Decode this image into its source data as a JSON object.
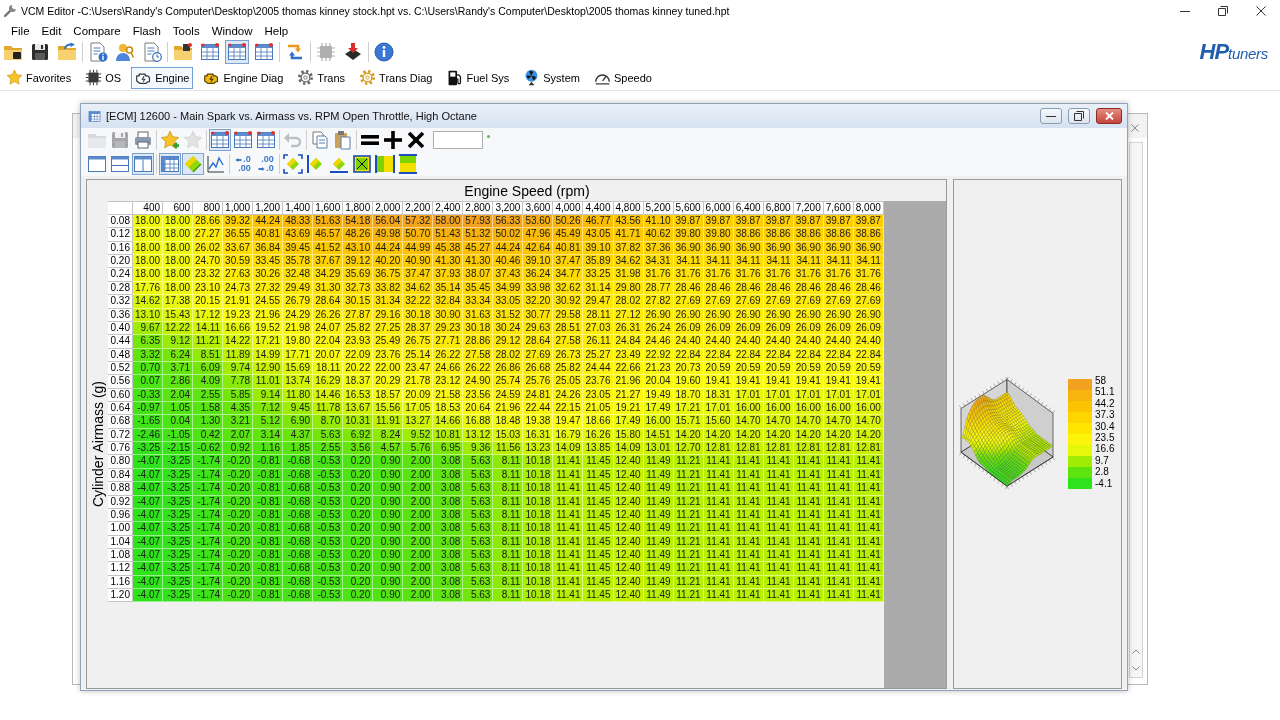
{
  "window": {
    "title": "VCM Editor -C:\\Users\\Randy's Computer\\Desktop\\2005 thomas kinney stock.hpt vs. C:\\Users\\Randy's Computer\\Desktop\\2005 thomas kinney tuned.hpt"
  },
  "menu": [
    "File",
    "Edit",
    "Compare",
    "Flash",
    "Tools",
    "Window",
    "Help"
  ],
  "toolbar": [
    [
      {
        "kind": "open-folder",
        "pressed": false,
        "disabled": false
      },
      {
        "kind": "save",
        "pressed": false,
        "disabled": false
      },
      {
        "kind": "folder-arrow",
        "pressed": false,
        "disabled": false
      }
    ],
    [
      {
        "kind": "doc-info",
        "pressed": false,
        "disabled": false
      },
      {
        "kind": "key-user",
        "pressed": false,
        "disabled": false
      },
      {
        "kind": "doc-clock",
        "pressed": false,
        "disabled": false
      }
    ],
    [
      {
        "kind": "folder-chip",
        "pressed": false,
        "disabled": false
      },
      {
        "kind": "table-grid",
        "pressed": false,
        "disabled": false
      },
      {
        "kind": "table-grid",
        "pressed": true,
        "disabled": false
      },
      {
        "kind": "table-grid",
        "pressed": false,
        "disabled": false
      }
    ],
    [
      {
        "kind": "swap",
        "pressed": false,
        "disabled": false
      }
    ],
    [
      {
        "kind": "chip",
        "pressed": false,
        "disabled": true
      },
      {
        "kind": "chip-down",
        "pressed": false,
        "disabled": false
      }
    ],
    [
      {
        "kind": "info",
        "pressed": false,
        "disabled": false
      }
    ]
  ],
  "logo": "**HP**tuners",
  "categories": [
    {
      "label": "Favorites",
      "kind": "star",
      "selected": false
    },
    {
      "label": "OS",
      "kind": "chip",
      "selected": false
    },
    {
      "label": "Engine",
      "kind": "engine",
      "selected": true
    },
    {
      "label": "Engine Diag",
      "kind": "engine-warning",
      "selected": false
    },
    {
      "label": "Trans",
      "kind": "gear",
      "selected": false
    },
    {
      "label": "Trans Diag",
      "kind": "gear-gold",
      "selected": false
    },
    {
      "label": "Fuel Sys",
      "kind": "fuel-pump",
      "selected": false
    },
    {
      "label": "System",
      "kind": "fan",
      "selected": false
    },
    {
      "label": "Speedo",
      "kind": "gauge",
      "selected": false
    }
  ],
  "editor": {
    "title": "[ECM] 12600 - Main Spark vs. Airmass vs. RPM Open Throttle, High Octane",
    "toolbar_1": [
      [
        {
          "kind": "folder",
          "pressed": false,
          "disabled": true
        },
        {
          "kind": "save",
          "pressed": false,
          "disabled": true
        },
        {
          "kind": "print",
          "pressed": false,
          "disabled": false
        }
      ],
      [
        {
          "kind": "star-add",
          "pressed": false,
          "disabled": false
        },
        {
          "kind": "star",
          "pressed": false,
          "disabled": true
        }
      ],
      [
        {
          "kind": "table-grid",
          "pressed": true,
          "disabled": false
        },
        {
          "kind": "table-grid",
          "pressed": false,
          "disabled": false
        },
        {
          "kind": "table-grid",
          "pressed": false,
          "disabled": false
        }
      ],
      [
        {
          "kind": "undo",
          "pressed": false,
          "disabled": true
        }
      ],
      [
        {
          "kind": "copy",
          "pressed": false,
          "disabled": false
        },
        {
          "kind": "paste",
          "pressed": false,
          "disabled": false
        }
      ],
      [
        {
          "kind": "equals",
          "pressed": false,
          "disabled": false
        },
        {
          "kind": "plus",
          "pressed": false,
          "disabled": false
        },
        {
          "kind": "times",
          "pressed": false,
          "disabled": false
        }
      ]
    ],
    "toolbar_2": [
      [
        {
          "kind": "pane-single",
          "pressed": false,
          "disabled": false
        },
        {
          "kind": "pane-rows",
          "pressed": false,
          "disabled": false
        },
        {
          "kind": "pane-columns",
          "pressed": true,
          "disabled": false
        }
      ],
      [
        {
          "kind": "grid-view",
          "pressed": true,
          "disabled": false
        },
        {
          "kind": "surface",
          "pressed": true,
          "disabled": false
        },
        {
          "kind": "line-graph",
          "pressed": false,
          "disabled": false
        }
      ],
      [
        {
          "kind": "fewer-decimals",
          "pressed": false,
          "disabled": false,
          "top": ".0",
          "bottom": ".00"
        },
        {
          "kind": "more-decimals",
          "pressed": false,
          "disabled": false,
          "top": ".00",
          "bottom": ".0"
        }
      ],
      [
        {
          "kind": "smooth-both",
          "pressed": false,
          "disabled": false
        },
        {
          "kind": "smooth-columns",
          "pressed": false,
          "disabled": false
        },
        {
          "kind": "smooth-rows",
          "pressed": false,
          "disabled": false
        },
        {
          "kind": "fill-box",
          "pressed": false,
          "disabled": false
        },
        {
          "kind": "fill-columns",
          "pressed": false,
          "disabled": false
        },
        {
          "kind": "fill-rows",
          "pressed": false,
          "disabled": false
        }
      ]
    ],
    "table": {
      "x_title": "Engine Speed (rpm)",
      "y_title": "Cylinder Airmass (g)",
      "columns": [
        "400",
        "600",
        "800",
        "1,000",
        "1,200",
        "1,400",
        "1,600",
        "1,800",
        "2,000",
        "2,200",
        "2,400",
        "2,800",
        "3,200",
        "3,600",
        "4,000",
        "4,400",
        "4,800",
        "5,200",
        "5,600",
        "6,000",
        "6,400",
        "6,800",
        "7,200",
        "7,600",
        "8,000"
      ],
      "rows": [
        {
          "airmass": "0.08",
          "cells": [
            "18.00",
            "18.00",
            "28.66",
            "39.32",
            "44.24",
            "48.33",
            "51.63",
            "54.18",
            "56.04",
            "57.32",
            "58.00",
            "57.93",
            "56.33",
            "53.60",
            "50.26",
            "46.77",
            "43.56",
            "41.10",
            "39.87",
            "39.87",
            "39.87",
            "39.87",
            "39.87",
            "39.87",
            "39.87"
          ]
        },
        {
          "airmass": "0.12",
          "cells": [
            "18.00",
            "18.00",
            "27.27",
            "36.55",
            "40.81",
            "43.69",
            "46.57",
            "48.26",
            "49.98",
            "50.70",
            "51.43",
            "51.32",
            "50.02",
            "47.96",
            "45.49",
            "43.05",
            "41.71",
            "40.62",
            "39.80",
            "39.80",
            "38.86",
            "38.86",
            "38.86",
            "38.86",
            "38.86"
          ]
        },
        {
          "airmass": "0.16",
          "cells": [
            "18.00",
            "18.00",
            "26.02",
            "33.67",
            "36.84",
            "39.45",
            "41.52",
            "43.10",
            "44.24",
            "44.99",
            "45.38",
            "45.27",
            "44.24",
            "42.64",
            "40.81",
            "39.10",
            "37.82",
            "37.36",
            "36.90",
            "36.90",
            "36.90",
            "36.90",
            "36.90",
            "36.90",
            "36.90"
          ]
        },
        {
          "airmass": "0.20",
          "cells": [
            "18.00",
            "18.00",
            "24.70",
            "30.59",
            "33.45",
            "35.78",
            "37.67",
            "39.12",
            "40.20",
            "40.90",
            "41.30",
            "41.30",
            "40.46",
            "39.10",
            "37.47",
            "35.89",
            "34.62",
            "34.31",
            "34.11",
            "34.11",
            "34.11",
            "34.11",
            "34.11",
            "34.11",
            "34.11"
          ]
        },
        {
          "airmass": "0.24",
          "cells": [
            "18.00",
            "18.00",
            "23.32",
            "27.63",
            "30.26",
            "32.48",
            "34.29",
            "35.69",
            "36.75",
            "37.47",
            "37.93",
            "38.07",
            "37.43",
            "36.24",
            "34.77",
            "33.25",
            "31.98",
            "31.76",
            "31.76",
            "31.76",
            "31.76",
            "31.76",
            "31.76",
            "31.76",
            "31.76"
          ]
        },
        {
          "airmass": "0.28",
          "cells": [
            "17.76",
            "18.00",
            "23.10",
            "24.73",
            "27.32",
            "29.49",
            "31.30",
            "32.73",
            "33.82",
            "34.62",
            "35.14",
            "35.45",
            "34.99",
            "33.98",
            "32.62",
            "31.14",
            "29.80",
            "28.77",
            "28.46",
            "28.46",
            "28.46",
            "28.46",
            "28.46",
            "28.46",
            "28.46"
          ]
        },
        {
          "airmass": "0.32",
          "cells": [
            "14.62",
            "17.38",
            "20.15",
            "21.91",
            "24.55",
            "26.79",
            "28.64",
            "30.15",
            "31.34",
            "32.22",
            "32.84",
            "33.34",
            "33.05",
            "32.20",
            "30.92",
            "29.47",
            "28.02",
            "27.82",
            "27.69",
            "27.69",
            "27.69",
            "27.69",
            "27.69",
            "27.69",
            "27.69"
          ]
        },
        {
          "airmass": "0.36",
          "cells": [
            "13.10",
            "15.43",
            "17.12",
            "19.23",
            "21.96",
            "24.29",
            "26.26",
            "27.87",
            "29.16",
            "30.18",
            "30.90",
            "31.63",
            "31.52",
            "30.77",
            "29.58",
            "28.11",
            "27.12",
            "26.90",
            "26.90",
            "26.90",
            "26.90",
            "26.90",
            "26.90",
            "26.90",
            "26.90"
          ]
        },
        {
          "airmass": "0.40",
          "cells": [
            "9.67",
            "12.22",
            "14.11",
            "16.66",
            "19.52",
            "21.98",
            "24.07",
            "25.82",
            "27.25",
            "28.37",
            "29.23",
            "30.18",
            "30.24",
            "29.63",
            "28.51",
            "27.03",
            "26.31",
            "26.24",
            "26.09",
            "26.09",
            "26.09",
            "26.09",
            "26.09",
            "26.09",
            "26.09"
          ]
        },
        {
          "airmass": "0.44",
          "cells": [
            "6.35",
            "9.12",
            "11.21",
            "14.22",
            "17.21",
            "19.80",
            "22.04",
            "23.93",
            "25.49",
            "26.75",
            "27.71",
            "28.86",
            "29.12",
            "28.64",
            "27.58",
            "26.11",
            "24.84",
            "24.46",
            "24.40",
            "24.40",
            "24.40",
            "24.40",
            "24.40",
            "24.40",
            "24.40"
          ]
        },
        {
          "airmass": "0.48",
          "cells": [
            "3.32",
            "6.24",
            "8.51",
            "11.89",
            "14.99",
            "17.71",
            "20.07",
            "22.09",
            "23.76",
            "25.14",
            "26.22",
            "27.58",
            "28.02",
            "27.69",
            "26.73",
            "25.27",
            "23.49",
            "22.92",
            "22.84",
            "22.84",
            "22.84",
            "22.84",
            "22.84",
            "22.84",
            "22.84"
          ]
        },
        {
          "airmass": "0.52",
          "cells": [
            "0.70",
            "3.71",
            "6.09",
            "9.74",
            "12.90",
            "15.69",
            "18.11",
            "20.22",
            "22.00",
            "23.47",
            "24.66",
            "26.22",
            "26.86",
            "26.68",
            "25.82",
            "24.44",
            "22.66",
            "21.23",
            "20.73",
            "20.59",
            "20.59",
            "20.59",
            "20.59",
            "20.59",
            "20.59"
          ]
        },
        {
          "airmass": "0.56",
          "cells": [
            "0.07",
            "2.86",
            "4.09",
            "7.78",
            "11.01",
            "13.74",
            "16.29",
            "18.37",
            "20.29",
            "21.78",
            "23.12",
            "24.90",
            "25.74",
            "25.76",
            "25.05",
            "23.76",
            "21.96",
            "20.04",
            "19.60",
            "19.41",
            "19.41",
            "19.41",
            "19.41",
            "19.41",
            "19.41"
          ]
        },
        {
          "airmass": "0.60",
          "cells": [
            "-0.33",
            "2.04",
            "2.55",
            "5.85",
            "9.14",
            "11.80",
            "14.46",
            "16.53",
            "18.57",
            "20.09",
            "21.58",
            "23.56",
            "24.59",
            "24.81",
            "24.26",
            "23.05",
            "21.27",
            "19.49",
            "18.70",
            "18.31",
            "17.01",
            "17.01",
            "17.01",
            "17.01",
            "17.01"
          ]
        },
        {
          "airmass": "0.64",
          "cells": [
            "-0.97",
            "1.05",
            "1.58",
            "4.35",
            "7.12",
            "9.45",
            "11.78",
            "13.67",
            "15.56",
            "17.05",
            "18.53",
            "20.64",
            "21.96",
            "22.44",
            "22.15",
            "21.05",
            "19.21",
            "17.49",
            "17.21",
            "17.01",
            "16.00",
            "16.00",
            "16.00",
            "16.00",
            "16.00"
          ]
        },
        {
          "airmass": "0.68",
          "cells": [
            "-1.65",
            "0.04",
            "1.30",
            "3.21",
            "5.12",
            "6.90",
            "8.70",
            "10.31",
            "11.91",
            "13.27",
            "14.66",
            "16.88",
            "18.48",
            "19.38",
            "19.47",
            "18.66",
            "17.49",
            "16.00",
            "15.71",
            "15.60",
            "14.70",
            "14.70",
            "14.70",
            "14.70",
            "14.70"
          ]
        },
        {
          "airmass": "0.72",
          "cells": [
            "-2.46",
            "-1.05",
            "0.42",
            "2.07",
            "3.14",
            "4.37",
            "5.63",
            "6.92",
            "8.24",
            "9.52",
            "10.81",
            "13.12",
            "15.03",
            "16.31",
            "16.79",
            "16.26",
            "15.80",
            "14.51",
            "14.20",
            "14.20",
            "14.20",
            "14.20",
            "14.20",
            "14.20",
            "14.20"
          ]
        },
        {
          "airmass": "0.76",
          "cells": [
            "-3.25",
            "-2.15",
            "-0.62",
            "0.92",
            "1.16",
            "1.85",
            "2.55",
            "3.56",
            "4.57",
            "5.76",
            "6.95",
            "9.36",
            "11.56",
            "13.23",
            "14.09",
            "13.85",
            "14.09",
            "13.01",
            "12.70",
            "12.81",
            "12.81",
            "12.81",
            "12.81",
            "12.81",
            "12.81"
          ]
        },
        {
          "airmass": "0.80",
          "cells": [
            "-4.07",
            "-3.25",
            "-1.74",
            "-0.20",
            "-0.81",
            "-0.68",
            "-0.53",
            "0.20",
            "0.90",
            "2.00",
            "3.08",
            "5.63",
            "8.11",
            "10.18",
            "11.41",
            "11.45",
            "12.40",
            "11.49",
            "11.21",
            "11.41",
            "11.41",
            "11.41",
            "11.41",
            "11.41",
            "11.41"
          ]
        },
        {
          "airmass": "0.84",
          "cells": [
            "-4.07",
            "-3.25",
            "-1.74",
            "-0.20",
            "-0.81",
            "-0.68",
            "-0.53",
            "0.20",
            "0.90",
            "2.00",
            "3.08",
            "5.63",
            "8.11",
            "10.18",
            "11.41",
            "11.45",
            "12.40",
            "11.49",
            "11.21",
            "11.41",
            "11.41",
            "11.41",
            "11.41",
            "11.41",
            "11.41"
          ]
        },
        {
          "airmass": "0.88",
          "cells": [
            "-4.07",
            "-3.25",
            "-1.74",
            "-0.20",
            "-0.81",
            "-0.68",
            "-0.53",
            "0.20",
            "0.90",
            "2.00",
            "3.08",
            "5.63",
            "8.11",
            "10.18",
            "11.41",
            "11.45",
            "12.40",
            "11.49",
            "11.21",
            "11.41",
            "11.41",
            "11.41",
            "11.41",
            "11.41",
            "11.41"
          ]
        },
        {
          "airmass": "0.92",
          "cells": [
            "-4.07",
            "-3.25",
            "-1.74",
            "-0.20",
            "-0.81",
            "-0.68",
            "-0.53",
            "0.20",
            "0.90",
            "2.00",
            "3.08",
            "5.63",
            "8.11",
            "10.18",
            "11.41",
            "11.45",
            "12.40",
            "11.49",
            "11.21",
            "11.41",
            "11.41",
            "11.41",
            "11.41",
            "11.41",
            "11.41"
          ]
        },
        {
          "airmass": "0.96",
          "cells": [
            "-4.07",
            "-3.25",
            "-1.74",
            "-0.20",
            "-0.81",
            "-0.68",
            "-0.53",
            "0.20",
            "0.90",
            "2.00",
            "3.08",
            "5.63",
            "8.11",
            "10.18",
            "11.41",
            "11.45",
            "12.40",
            "11.49",
            "11.21",
            "11.41",
            "11.41",
            "11.41",
            "11.41",
            "11.41",
            "11.41"
          ]
        },
        {
          "airmass": "1.00",
          "cells": [
            "-4.07",
            "-3.25",
            "-1.74",
            "-0.20",
            "-0.81",
            "-0.68",
            "-0.53",
            "0.20",
            "0.90",
            "2.00",
            "3.08",
            "5.63",
            "8.11",
            "10.18",
            "11.41",
            "11.45",
            "12.40",
            "11.49",
            "11.21",
            "11.41",
            "11.41",
            "11.41",
            "11.41",
            "11.41",
            "11.41"
          ]
        },
        {
          "airmass": "1.04",
          "cells": [
            "-4.07",
            "-3.25",
            "-1.74",
            "-0.20",
            "-0.81",
            "-0.68",
            "-0.53",
            "0.20",
            "0.90",
            "2.00",
            "3.08",
            "5.63",
            "8.11",
            "10.18",
            "11.41",
            "11.45",
            "12.40",
            "11.49",
            "11.21",
            "11.41",
            "11.41",
            "11.41",
            "11.41",
            "11.41",
            "11.41"
          ]
        },
        {
          "airmass": "1.08",
          "cells": [
            "-4.07",
            "-3.25",
            "-1.74",
            "-0.20",
            "-0.81",
            "-0.68",
            "-0.53",
            "0.20",
            "0.90",
            "2.00",
            "3.08",
            "5.63",
            "8.11",
            "10.18",
            "11.41",
            "11.45",
            "12.40",
            "11.49",
            "11.21",
            "11.41",
            "11.41",
            "11.41",
            "11.41",
            "11.41",
            "11.41"
          ]
        },
        {
          "airmass": "1.12",
          "cells": [
            "-4.07",
            "-3.25",
            "-1.74",
            "-0.20",
            "-0.81",
            "-0.68",
            "-0.53",
            "0.20",
            "0.90",
            "2.00",
            "3.08",
            "5.63",
            "8.11",
            "10.18",
            "11.41",
            "11.45",
            "12.40",
            "11.49",
            "11.21",
            "11.41",
            "11.41",
            "11.41",
            "11.41",
            "11.41",
            "11.41"
          ]
        },
        {
          "airmass": "1.16",
          "cells": [
            "-4.07",
            "-3.25",
            "-1.74",
            "-0.20",
            "-0.81",
            "-0.68",
            "-0.53",
            "0.20",
            "0.90",
            "2.00",
            "3.08",
            "5.63",
            "8.11",
            "10.18",
            "11.41",
            "11.45",
            "12.40",
            "11.49",
            "11.21",
            "11.41",
            "11.41",
            "11.41",
            "11.41",
            "11.41",
            "11.41"
          ]
        },
        {
          "airmass": "1.20",
          "cells": [
            "-4.07",
            "-3.25",
            "-1.74",
            "-0.20",
            "-0.81",
            "-0.68",
            "-0.53",
            "0.20",
            "0.90",
            "2.00",
            "3.08",
            "5.63",
            "8.11",
            "10.18",
            "11.41",
            "11.45",
            "12.40",
            "11.49",
            "11.21",
            "11.41",
            "11.41",
            "11.41",
            "11.41",
            "11.41",
            "11.41"
          ]
        }
      ]
    },
    "scale": [
      "58",
      "51.1",
      "44.2",
      "37.3",
      "30.4",
      "23.5",
      "16.6",
      "9.7",
      "2.8",
      "-4.1"
    ]
  }
}
